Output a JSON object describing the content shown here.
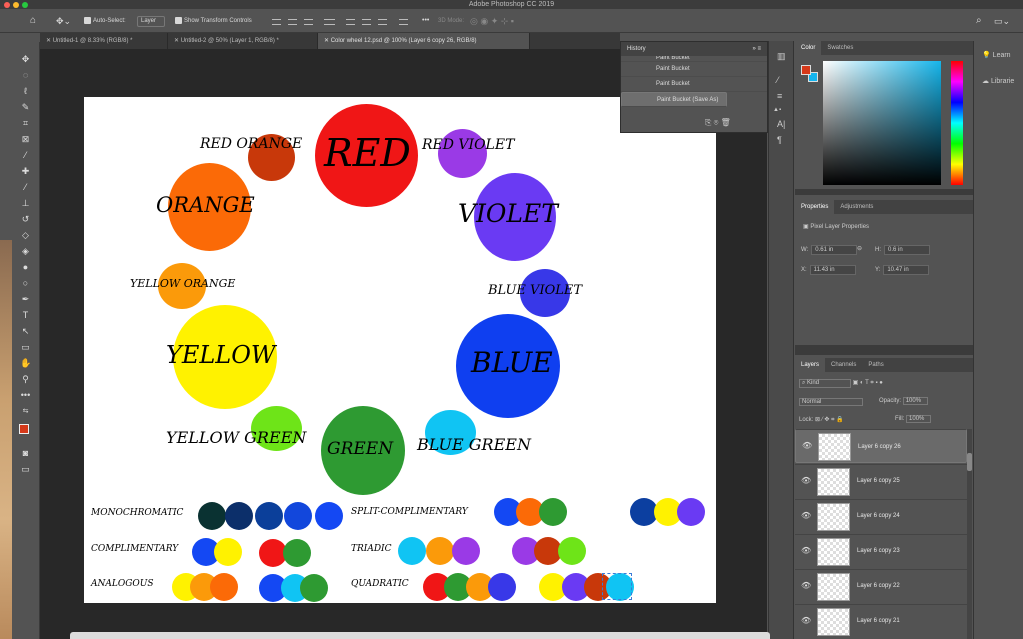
{
  "app": {
    "title": "Adobe Photoshop CC 2019"
  },
  "options": {
    "auto_select": "Auto-Select:",
    "layer_select": "Layer",
    "show_transform": "Show Transform Controls",
    "more": "•••",
    "mode_3d": "3D Mode:"
  },
  "tabs": [
    {
      "label": "Untitled-1 @ 8.33% (RGB/8) *"
    },
    {
      "label": "Untitled-2 @ 50% (Layer 1, RGB/8) *"
    },
    {
      "label": "Color wheel 12.psd @ 100% (Layer 6 copy 26, RGB/8)"
    }
  ],
  "canvas": {
    "wheel": [
      {
        "label": "RED",
        "color": "#f01616"
      },
      {
        "label": "RED ORANGE",
        "color": "#c8380a"
      },
      {
        "label": "RED VIOLET",
        "color": "#9a3ae6"
      },
      {
        "label": "ORANGE",
        "color": "#fb6a07"
      },
      {
        "label": "VIOLET",
        "color": "#6a3af3"
      },
      {
        "label": "YELLOW ORANGE",
        "color": "#fb9a0a"
      },
      {
        "label": "BLUE VIOLET",
        "color": "#3838e8"
      },
      {
        "label": "YELLOW",
        "color": "#fff200"
      },
      {
        "label": "BLUE",
        "color": "#0f3ff0"
      },
      {
        "label": "YELLOW GREEN",
        "color": "#6ee418"
      },
      {
        "label": "GREEN",
        "color": "#2e9a32"
      },
      {
        "label": "BLUE GREEN",
        "color": "#10c4f3"
      }
    ],
    "schemes": [
      {
        "label": "MONOCHROMATIC",
        "colors": [
          "#0a3232",
          "#0c2f6a",
          "#0b3f9a",
          "#1247dc",
          "#1448f3"
        ]
      },
      {
        "label": "COMPLIMENTARY",
        "colors": [
          "#1448f3",
          "#fff200",
          "#f01616",
          "#2e9a32"
        ]
      },
      {
        "label": "ANALOGOUS",
        "colors": [
          "#fff200",
          "#fb9a0a",
          "#fb6a07",
          "#1448f3",
          "#10c4f3",
          "#2e9a32"
        ]
      },
      {
        "label": "SPLIT-COMPLIMENTARY",
        "colors": [
          "#1448f3",
          "#fb6a07",
          "#2e9a32",
          "#0c3fa0",
          "#fff200",
          "#6a3af3"
        ]
      },
      {
        "label": "TRIADIC",
        "colors": [
          "#10c4f3",
          "#fb9a0a",
          "#9a3ae6",
          "#9a3ae6",
          "#c8380a",
          "#6ee418"
        ]
      },
      {
        "label": "QUADRATIC",
        "colors": [
          "#f01616",
          "#2e9a32",
          "#fb9a0a",
          "#3838e8",
          "#fff200",
          "#6a3af3",
          "#c8380a",
          "#10c4f3"
        ]
      }
    ]
  },
  "history": {
    "title": "History",
    "items": [
      "Paint Bucket",
      "Paint Bucket",
      "Paint Bucket",
      "Paint Bucket (Save As)"
    ]
  },
  "color_panel": {
    "tabs": [
      "Color",
      "Swatches"
    ]
  },
  "properties": {
    "tabs": [
      "Properties",
      "Adjustments"
    ],
    "subtitle": "Pixel Layer Properties",
    "w_label": "W:",
    "w": "0.61 in",
    "h_label": "H:",
    "h": "0.6 in",
    "x_label": "X:",
    "x": "11.43 in",
    "y_label": "Y:",
    "y": "10.47 in"
  },
  "layers": {
    "tabs": [
      "Layers",
      "Channels",
      "Paths"
    ],
    "kind": "Kind",
    "blend": "Normal",
    "opacity_label": "Opacity:",
    "opacity": "100%",
    "lock_label": "Lock:",
    "fill_label": "Fill:",
    "fill": "100%",
    "items": [
      "Layer 6 copy 26",
      "Layer 6 copy 25",
      "Layer 6 copy 24",
      "Layer 6 copy 23",
      "Layer 6 copy 22",
      "Layer 6 copy 21"
    ]
  },
  "far_right": {
    "learn": "Learn",
    "libraries": "Librarie"
  }
}
